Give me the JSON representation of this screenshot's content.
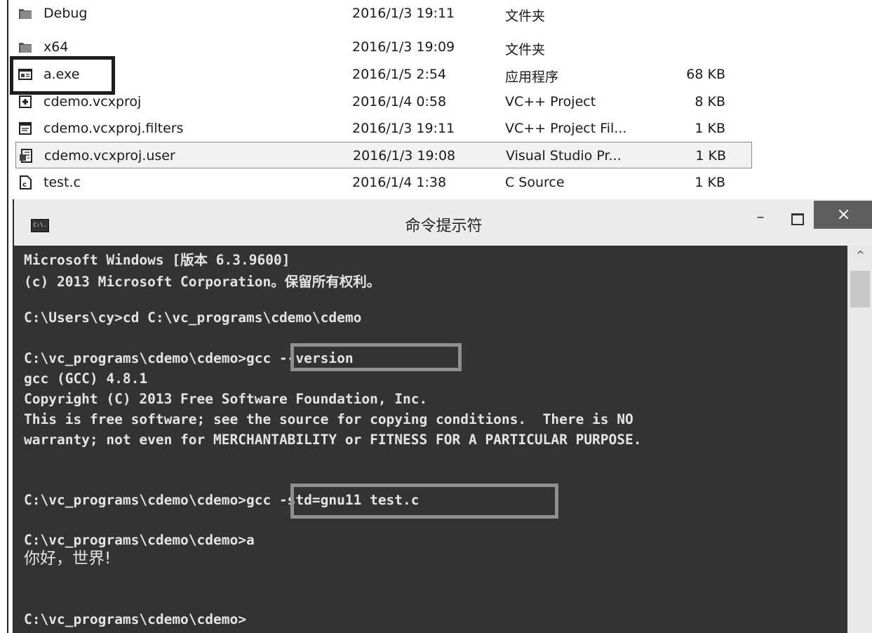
{
  "explorer": {
    "files": [
      {
        "name": "Debug",
        "date": "2016/1/3 19:11",
        "type": "文件夹",
        "size": "",
        "icon": "folder-icon"
      },
      {
        "name": "x64",
        "date": "2016/1/3 19:09",
        "type": "文件夹",
        "size": "",
        "icon": "folder-icon"
      },
      {
        "name": "a.exe",
        "date": "2016/1/5 2:54",
        "type": "应用程序",
        "size": "68 KB",
        "icon": "application-icon"
      },
      {
        "name": "cdemo.vcxproj",
        "date": "2016/1/4 0:58",
        "type": "VC++ Project",
        "size": "8 KB",
        "icon": "vcxproj-icon"
      },
      {
        "name": "cdemo.vcxproj.filters",
        "date": "2016/1/3 19:11",
        "type": "VC++ Project Fil...",
        "size": "1 KB",
        "icon": "filters-file-icon"
      },
      {
        "name": "cdemo.vcxproj.user",
        "date": "2016/1/3 19:08",
        "type": "Visual Studio Pr...",
        "size": "1 KB",
        "icon": "user-file-icon"
      },
      {
        "name": "test.c",
        "date": "2016/1/4 1:38",
        "type": "C Source",
        "size": "1 KB",
        "icon": "c-source-icon"
      }
    ],
    "selected_index": 5
  },
  "cmd": {
    "title": "命令提示符",
    "app_icon_text": "C:\\.",
    "minimize_glyph": "–",
    "close_glyph": "×",
    "scroll_up_glyph": "^",
    "lines": [
      "Microsoft Windows [版本 6.3.9600]",
      "(c) 2013 Microsoft Corporation。保留所有权利。",
      "",
      "C:\\Users\\cy>cd C:\\vc_programs\\cdemo\\cdemo",
      "",
      "C:\\vc_programs\\cdemo\\cdemo>gcc --version",
      "gcc (GCC) 4.8.1",
      "Copyright (C) 2013 Free Software Foundation, Inc.",
      "This is free software; see the source for copying conditions.  There is NO",
      "warranty; not even for MERCHANTABILITY or FITNESS FOR A PARTICULAR PURPOSE.",
      "",
      "",
      "C:\\vc_programs\\cdemo\\cdemo>gcc -std=gnu11 test.c",
      "",
      "C:\\vc_programs\\cdemo\\cdemo>a",
      "你好，世界!",
      "",
      "",
      "C:\\vc_programs\\cdemo\\cdemo>"
    ]
  },
  "colors": {
    "console_bg": "#333333",
    "console_text": "#e4e4e4",
    "callout_grey": "#8f8f8f",
    "callout_dark": "#1e1e1e",
    "close_button": "#5e5e5e"
  }
}
